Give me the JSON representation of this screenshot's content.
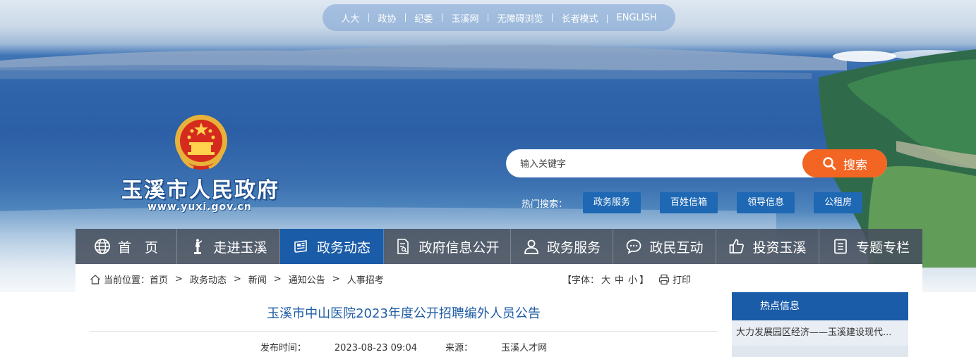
{
  "top_links": [
    "人大",
    "政协",
    "纪委",
    "玉溪网",
    "无障碍浏览",
    "长者模式",
    "ENGLISH"
  ],
  "logo": {
    "site_name": "玉溪市人民政府",
    "site_url": "www.yuxi.gov.cn"
  },
  "search": {
    "placeholder": "输入关键字",
    "button_label": "搜索",
    "hot_label": "热门搜索：",
    "hot_keywords": [
      "政务服务",
      "百姓信箱",
      "领导信息",
      "公租房"
    ]
  },
  "nav": {
    "active": "政务动态",
    "items": [
      {
        "label": "首　页",
        "icon": "globe-icon"
      },
      {
        "label": "走进玉溪",
        "icon": "statue-icon"
      },
      {
        "label": "政务动态",
        "icon": "newspaper-icon"
      },
      {
        "label": "政府信息公开",
        "icon": "document-search-icon"
      },
      {
        "label": "政务服务",
        "icon": "user-icon"
      },
      {
        "label": "政民互动",
        "icon": "chat-icon"
      },
      {
        "label": "投资玉溪",
        "icon": "thumbs-up-icon"
      },
      {
        "label": "专题专栏",
        "icon": "list-icon"
      }
    ]
  },
  "breadcrumb": {
    "label": "当前位置：",
    "items": [
      "首页",
      "政务动态",
      "新闻",
      "通知公告",
      "人事招考"
    ],
    "separator": ">"
  },
  "font_size": {
    "label": "【字体：",
    "sizes": [
      "大",
      "中",
      "小"
    ],
    "close": "】"
  },
  "print_label": "打印",
  "article": {
    "title": "玉溪市中山医院2023年度公开招聘编外人员公告",
    "publish_label": "发布时间：",
    "publish_time": "2023-08-23 09:04",
    "source_label": "来源：",
    "source": "玉溪人才网"
  },
  "sidebar": {
    "title": "热点信息",
    "items": [
      "大力发展园区经济——玉溪建设现代..."
    ]
  },
  "colors": {
    "nav_active": "#1a5ca8",
    "search_button": "#f26522",
    "hot_tag": "#1e68b4",
    "title": "#1e5ca4"
  }
}
